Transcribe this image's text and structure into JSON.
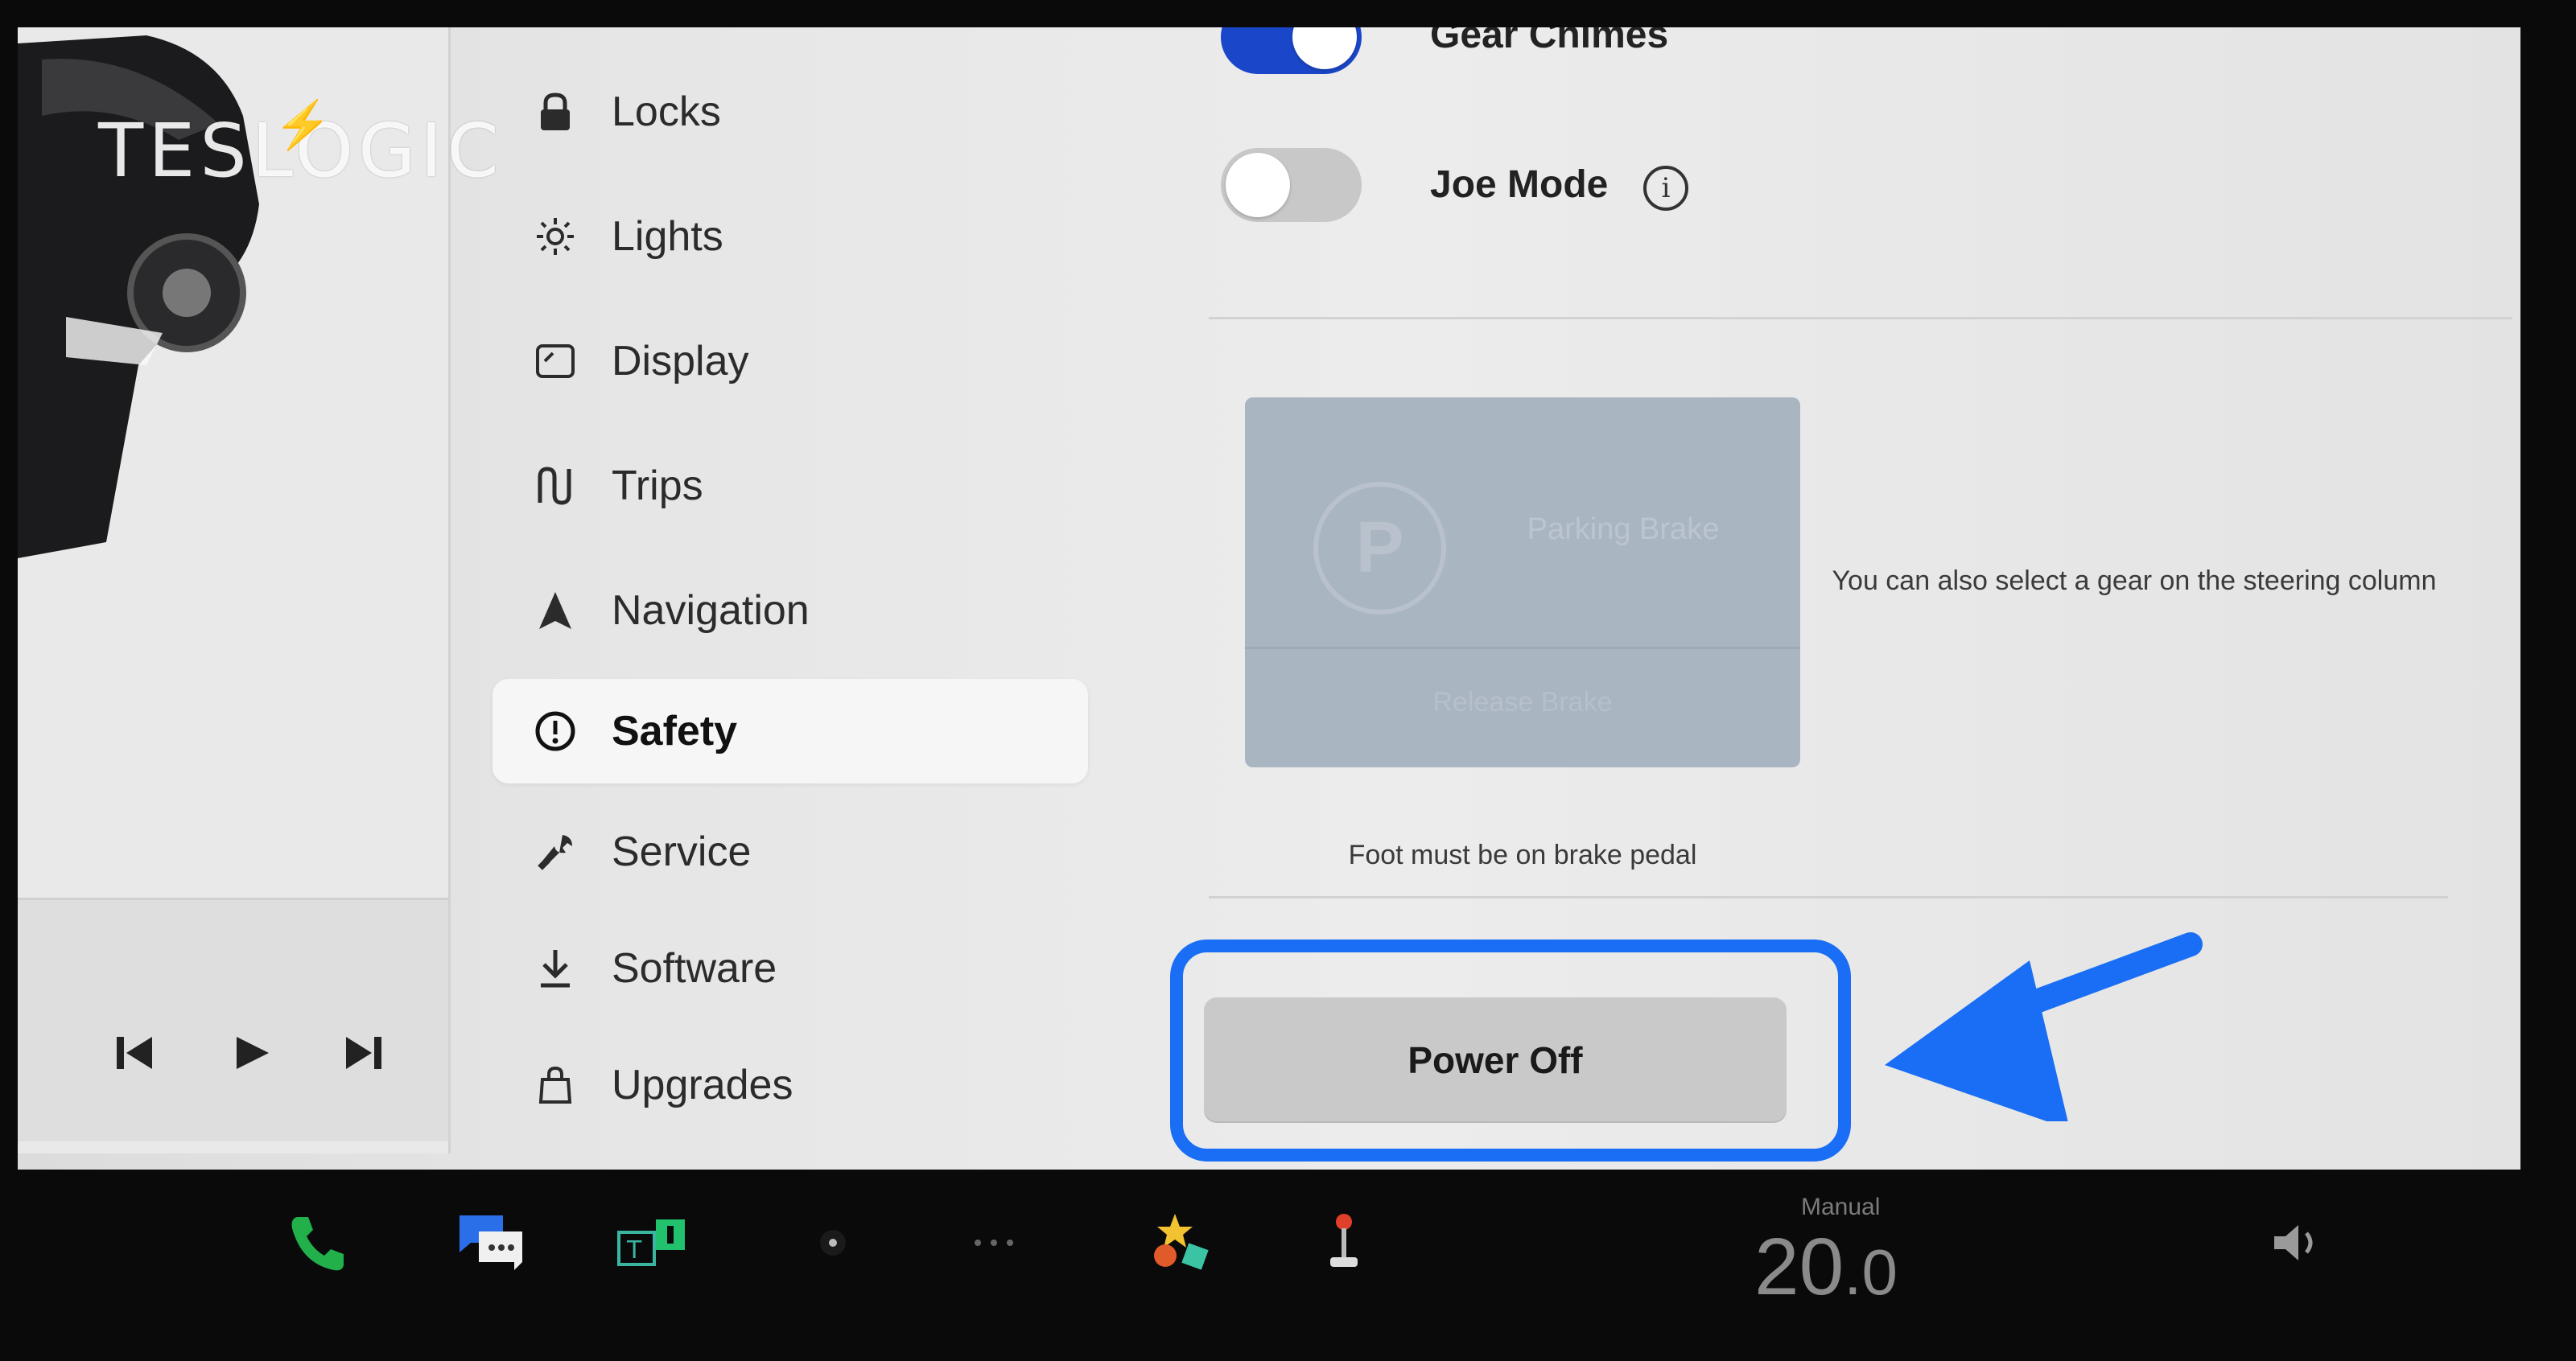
{
  "brand": "TESLOGIC",
  "media": {
    "prev_icon": "skip-back-icon",
    "play_icon": "play-icon",
    "next_icon": "skip-forward-icon"
  },
  "menu": {
    "items": [
      {
        "label": "Locks",
        "icon": "lock-icon"
      },
      {
        "label": "Lights",
        "icon": "light-icon"
      },
      {
        "label": "Display",
        "icon": "display-icon"
      },
      {
        "label": "Trips",
        "icon": "trips-icon"
      },
      {
        "label": "Navigation",
        "icon": "navigation-icon"
      },
      {
        "label": "Safety",
        "icon": "alert-circle-icon",
        "active": true
      },
      {
        "label": "Service",
        "icon": "wrench-icon"
      },
      {
        "label": "Software",
        "icon": "download-icon"
      },
      {
        "label": "Upgrades",
        "icon": "bag-icon"
      }
    ]
  },
  "settings": {
    "gear_chimes": {
      "label": "Gear Chimes",
      "on": true
    },
    "joe_mode": {
      "label": "Joe Mode",
      "on": false
    }
  },
  "shift_panel": {
    "brake_label": "Parking Brake",
    "bottom_label": "Release Brake",
    "caption": "Foot must be on brake pedal"
  },
  "steering_note": "You can also select a gear on the steering column",
  "power_off_label": "Power Off",
  "dock": {
    "climate_mode": "Manual",
    "temperature_whole": "20",
    "temperature_decimal": ".0"
  },
  "colors": {
    "accent": "#1a6ef5",
    "toggle_on": "#1a47c9"
  }
}
